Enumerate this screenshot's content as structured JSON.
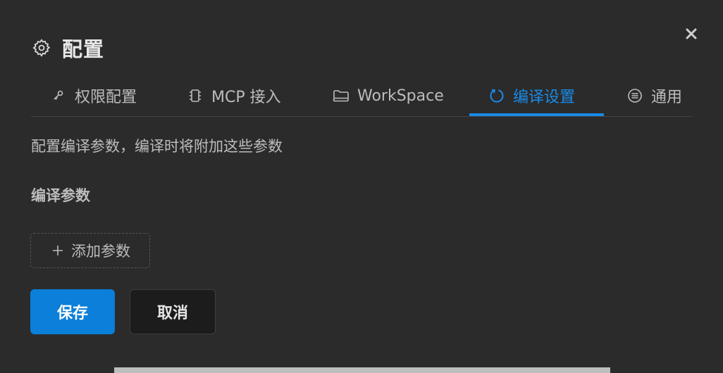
{
  "dialog": {
    "title": "配置",
    "title_icon": "gear-icon",
    "close_icon": "close-icon",
    "close_glyph": "×"
  },
  "tabs": [
    {
      "label": "权限配置",
      "icon": "key-icon",
      "active": false
    },
    {
      "label": "MCP 接入",
      "icon": "chip-icon",
      "active": false
    },
    {
      "label": "WorkSpace",
      "icon": "folder-icon",
      "active": false
    },
    {
      "label": "编译设置",
      "icon": "refresh-icon",
      "active": true
    },
    {
      "label": "通用",
      "icon": "list-circle-icon",
      "active": false
    }
  ],
  "compile": {
    "description": "配置编译参数，编译时将附加这些参数",
    "params_label": "编译参数",
    "add_param_label": "添加参数"
  },
  "actions": {
    "save_label": "保存",
    "cancel_label": "取消"
  },
  "colors": {
    "background": "#2b2b2c",
    "accent": "#1a8ae6",
    "primary_button": "#0b7fd9",
    "text": "#bdbdbd"
  }
}
